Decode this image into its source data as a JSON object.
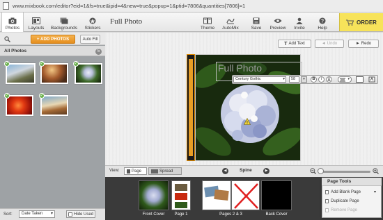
{
  "browser": {
    "url": "www.mixbook.com/editor?eid=1&fs=true&ipid=4&new=true&popup=1&ptid=7806&quantities[7806]=1"
  },
  "toolbar": {
    "left_tabs": [
      {
        "label": "Photos",
        "icon": "camera-icon"
      },
      {
        "label": "Layouts",
        "icon": "layouts-icon"
      },
      {
        "label": "Backgrounds",
        "icon": "backgrounds-icon"
      },
      {
        "label": "Stickers",
        "icon": "stickers-icon"
      }
    ],
    "title": "Full Photo",
    "right_buttons": [
      {
        "label": "Theme",
        "icon": "theme-icon"
      },
      {
        "label": "AutoMix",
        "icon": "automix-icon"
      },
      {
        "label": "Save",
        "icon": "save-icon"
      },
      {
        "label": "Preview",
        "icon": "eye-icon"
      },
      {
        "label": "Invite",
        "icon": "invite-icon"
      },
      {
        "label": "Help",
        "icon": "help-icon"
      }
    ],
    "order_label": "ORDER"
  },
  "left_panel": {
    "add_photos_label": "+ ADD PHOTOS",
    "auto_fill_label": "Auto Fill",
    "all_photos_label": "All Photos",
    "photo_count": "5",
    "sort_label": "Sort:",
    "sort_value": "Date Taken",
    "hide_used_label": "Hide Used"
  },
  "canvas": {
    "add_text_label": "Add Text",
    "undo_label": "Undo",
    "redo_label": "Redo",
    "page_title": "Full Photo",
    "font_name": "Century Gothic",
    "font_size": "58",
    "format_b": "B",
    "format_i": "I",
    "format_u": "U",
    "colors": {
      "spine": "#e69d25",
      "order": "#f7e35a"
    }
  },
  "view_bar": {
    "view_label": "View:",
    "page_label": "Page",
    "spread_label": "Spread",
    "spine_label": "Spine"
  },
  "filmstrip": {
    "labels": [
      "Front Cover",
      "Page 1",
      "Pages 2 & 3",
      "Back Cover"
    ]
  },
  "page_tools": {
    "title": "Page Tools",
    "add_blank": "Add Blank Page",
    "duplicate": "Duplicate Page",
    "remove": "Remove Page"
  }
}
